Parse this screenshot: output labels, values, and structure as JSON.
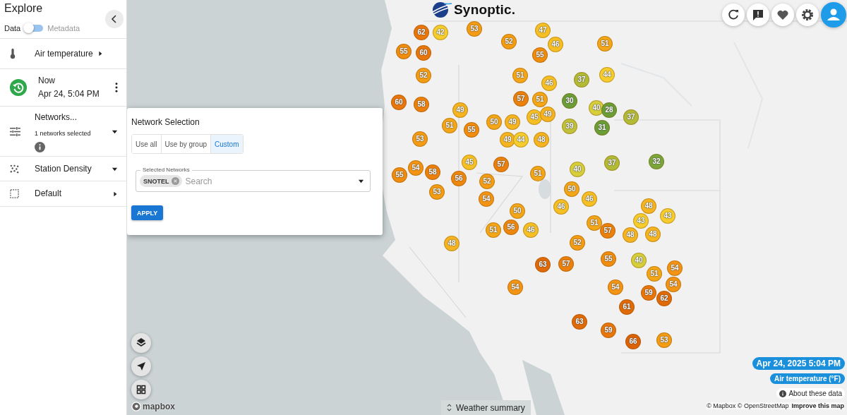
{
  "sidebar": {
    "title": "Explore",
    "view_options": [
      {
        "label": "Data",
        "selected": true
      },
      {
        "label": "Metadata",
        "selected": false
      }
    ],
    "items": [
      {
        "kind": "variable",
        "label": "Air temperature",
        "dropdown": false
      },
      {
        "kind": "time",
        "label": "Now",
        "value": "Apr 24, 5:04 PM"
      },
      {
        "kind": "networks",
        "label": "Networks...",
        "sub": "1 networks selected",
        "dropdown": true
      },
      {
        "kind": "density",
        "label": "Station Density",
        "dropdown": true
      },
      {
        "kind": "style",
        "label": "Default",
        "dropdown": false
      }
    ]
  },
  "network_popup": {
    "title": "Network Selection",
    "tabs": [
      {
        "label": "Use all",
        "selected": false
      },
      {
        "label": "Use by group",
        "selected": false
      },
      {
        "label": "Custom",
        "selected": true
      }
    ],
    "field": {
      "label": "Selected Networks",
      "chips": [
        "SNOTEL"
      ],
      "placeholder": "Search"
    },
    "button": "APPLY"
  },
  "logo": "Synoptic.",
  "stations": [
    {
      "value": "62",
      "color": "#e8760c"
    },
    {
      "value": "42",
      "color": "#f6cd2c"
    },
    {
      "value": "53",
      "color": "#f39c14"
    },
    {
      "value": "47",
      "color": "#f6c025"
    },
    {
      "value": "55",
      "color": "#f08c0e"
    },
    {
      "value": "60",
      "color": "#e8760c"
    },
    {
      "value": "52",
      "color": "#f39c14"
    },
    {
      "value": "46",
      "color": "#f6c025"
    },
    {
      "value": "51",
      "color": "#f4a619"
    },
    {
      "value": "55",
      "color": "#f08c0e"
    },
    {
      "value": "52",
      "color": "#f39c14"
    },
    {
      "value": "51",
      "color": "#f4a619"
    },
    {
      "value": "46",
      "color": "#f6c025"
    },
    {
      "value": "37",
      "color": "#b3bb36"
    },
    {
      "value": "44",
      "color": "#f6cd2c"
    },
    {
      "value": "60",
      "color": "#e8760c"
    },
    {
      "value": "58",
      "color": "#eb800d"
    },
    {
      "value": "49",
      "color": "#f6b520"
    },
    {
      "value": "57",
      "color": "#eb800d"
    },
    {
      "value": "51",
      "color": "#f4a619"
    },
    {
      "value": "30",
      "color": "#6b9e36"
    },
    {
      "value": "40",
      "color": "#d6ce3a"
    },
    {
      "value": "28",
      "color": "#6b9e36"
    },
    {
      "value": "51",
      "color": "#f4a619"
    },
    {
      "value": "55",
      "color": "#f08c0e"
    },
    {
      "value": "50",
      "color": "#f4a619"
    },
    {
      "value": "49",
      "color": "#f6b520"
    },
    {
      "value": "45",
      "color": "#f6c025"
    },
    {
      "value": "49",
      "color": "#f6b520"
    },
    {
      "value": "39",
      "color": "#c2c23a"
    },
    {
      "value": "31",
      "color": "#6b9e36"
    },
    {
      "value": "37",
      "color": "#b3bb36"
    },
    {
      "value": "53",
      "color": "#f39c14"
    },
    {
      "value": "49",
      "color": "#f6b520"
    },
    {
      "value": "44",
      "color": "#f6cd2c"
    },
    {
      "value": "48",
      "color": "#f6b520"
    },
    {
      "value": "45",
      "color": "#f6c025"
    },
    {
      "value": "57",
      "color": "#eb800d"
    },
    {
      "value": "51",
      "color": "#f4a619"
    },
    {
      "value": "40",
      "color": "#d6ce3a"
    },
    {
      "value": "37",
      "color": "#b3bb36"
    },
    {
      "value": "32",
      "color": "#7aa63a"
    },
    {
      "value": "55",
      "color": "#f08c0e"
    },
    {
      "value": "54",
      "color": "#f39414"
    },
    {
      "value": "58",
      "color": "#eb800d"
    },
    {
      "value": "56",
      "color": "#ee870e"
    },
    {
      "value": "52",
      "color": "#f39c14"
    },
    {
      "value": "53",
      "color": "#f39c14"
    },
    {
      "value": "54",
      "color": "#f39414"
    },
    {
      "value": "50",
      "color": "#f4a619"
    },
    {
      "value": "46",
      "color": "#f6c025"
    },
    {
      "value": "46",
      "color": "#f6c025"
    },
    {
      "value": "50",
      "color": "#f4a619"
    },
    {
      "value": "48",
      "color": "#f6b520"
    },
    {
      "value": "43",
      "color": "#f6cd2c"
    },
    {
      "value": "51",
      "color": "#f4a619"
    },
    {
      "value": "56",
      "color": "#ee870e"
    },
    {
      "value": "46",
      "color": "#f6c025"
    },
    {
      "value": "51",
      "color": "#f4a619"
    },
    {
      "value": "43",
      "color": "#f6cd2c"
    },
    {
      "value": "57",
      "color": "#eb800d"
    },
    {
      "value": "48",
      "color": "#f6b520"
    },
    {
      "value": "48",
      "color": "#f6b520"
    },
    {
      "value": "48",
      "color": "#f6b520"
    },
    {
      "value": "52",
      "color": "#f39c14"
    },
    {
      "value": "63",
      "color": "#e06a08"
    },
    {
      "value": "57",
      "color": "#eb800d"
    },
    {
      "value": "55",
      "color": "#f08c0e"
    },
    {
      "value": "40",
      "color": "#d6ce3a"
    },
    {
      "value": "51",
      "color": "#f4a619"
    },
    {
      "value": "54",
      "color": "#f39414"
    },
    {
      "value": "54",
      "color": "#f39414"
    },
    {
      "value": "54",
      "color": "#f39414"
    },
    {
      "value": "59",
      "color": "#e8760c"
    },
    {
      "value": "54",
      "color": "#f39414"
    },
    {
      "value": "62",
      "color": "#e06a08"
    },
    {
      "value": "61",
      "color": "#e06a08"
    },
    {
      "value": "63",
      "color": "#e06a08"
    },
    {
      "value": "59",
      "color": "#e8760c"
    },
    {
      "value": "66",
      "color": "#dc6206"
    },
    {
      "value": "53",
      "color": "#f39c14"
    }
  ],
  "legend": {
    "time": "Apr 24, 2025 5:04 PM",
    "variable": "Air temperature (°F)",
    "about": "About these data"
  },
  "attribution": {
    "credit": "© Mapbox © OpenStreetMap",
    "link": "Improve this map"
  },
  "mapbox_logo": "mapbox",
  "summary_button": "Weather summary"
}
